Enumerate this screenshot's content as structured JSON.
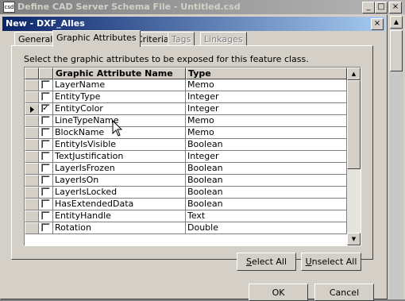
{
  "background_window": {
    "title": "Define CAD Server Schema File - Untitled.csd",
    "minimize_label": "_",
    "maximize_label": "□",
    "close_label": "×"
  },
  "dialog": {
    "title": "New - DXF_Alles",
    "close_label": "×",
    "tabs": [
      {
        "label": "General",
        "state": "normal"
      },
      {
        "label": "Graphic Attributes",
        "state": "active"
      },
      {
        "label": "Criteria",
        "state": "normal"
      },
      {
        "label": "Tags",
        "state": "disabled"
      },
      {
        "label": "Linkages",
        "state": "disabled"
      }
    ],
    "instructions": "Select the graphic attributes to be exposed for this feature class.",
    "grid": {
      "columns": [
        "Graphic Attribute Name",
        "Type"
      ],
      "rows": [
        {
          "name": "LayerName",
          "type": "Memo",
          "checked": false,
          "current": false
        },
        {
          "name": "EntityType",
          "type": "Integer",
          "checked": false,
          "current": false
        },
        {
          "name": "EntityColor",
          "type": "Integer",
          "checked": true,
          "current": true
        },
        {
          "name": "LineTypeName",
          "type": "Memo",
          "checked": false,
          "current": false
        },
        {
          "name": "BlockName",
          "type": "Memo",
          "checked": false,
          "current": false
        },
        {
          "name": "EntityIsVisible",
          "type": "Boolean",
          "checked": false,
          "current": false
        },
        {
          "name": "TextJustification",
          "type": "Integer",
          "checked": false,
          "current": false
        },
        {
          "name": "LayerIsFrozen",
          "type": "Boolean",
          "checked": false,
          "current": false
        },
        {
          "name": "LayerIsOn",
          "type": "Boolean",
          "checked": false,
          "current": false
        },
        {
          "name": "LayerIsLocked",
          "type": "Boolean",
          "checked": false,
          "current": false
        },
        {
          "name": "HasExtendedData",
          "type": "Boolean",
          "checked": false,
          "current": false
        },
        {
          "name": "EntityHandle",
          "type": "Text",
          "checked": false,
          "current": false
        },
        {
          "name": "Rotation",
          "type": "Double",
          "checked": false,
          "current": false
        }
      ]
    },
    "buttons": {
      "select_all_prefix": "S",
      "select_all_rest": "elect All",
      "unselect_all_prefix": "U",
      "unselect_all_rest": "nselect All",
      "ok": "OK",
      "cancel": "Cancel"
    }
  },
  "colors": {
    "active_title_start": "#0a246a",
    "active_title_end": "#a6caf0",
    "face": "#d4d0c8"
  }
}
